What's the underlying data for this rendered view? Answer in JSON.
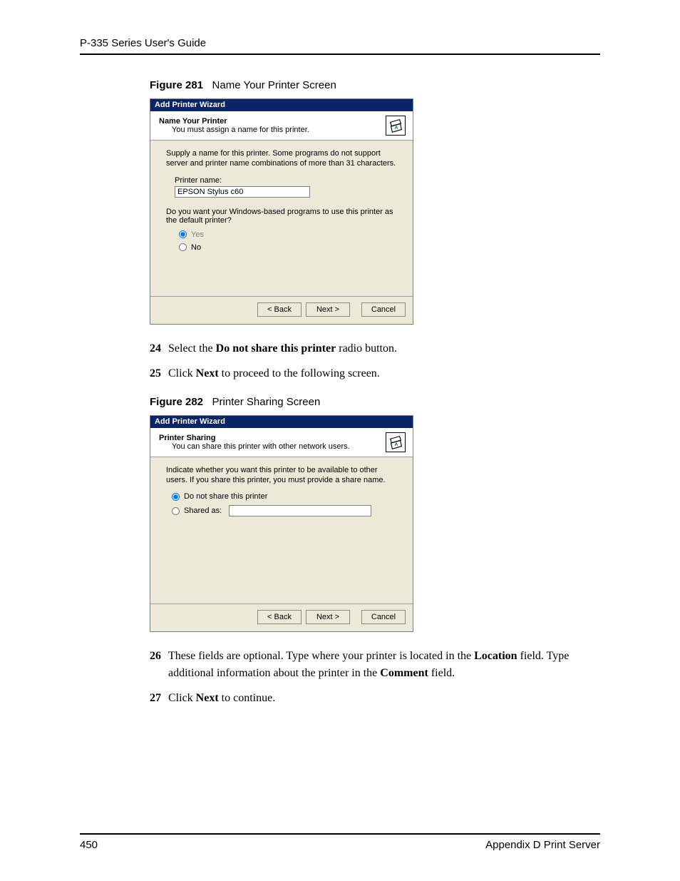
{
  "header": {
    "running_head": "P-335 Series User's Guide"
  },
  "figure281": {
    "caption_num": "Figure 281",
    "caption_title": "Name Your Printer Screen",
    "dialog": {
      "title": "Add Printer Wizard",
      "heading": "Name Your Printer",
      "sub": "You must assign a name for this printer.",
      "intro": "Supply a name for this printer. Some programs do not support server and printer name combinations of more than 31 characters.",
      "printer_name_label": "Printer name:",
      "printer_name_value": "EPSON Stylus c60",
      "question": "Do you want your Windows-based programs to use this printer as the default printer?",
      "yes": "Yes",
      "no": "No",
      "back": "< Back",
      "next": "Next >",
      "cancel": "Cancel"
    }
  },
  "steps_a": {
    "s24": {
      "num": "24",
      "text_pre": "Select the ",
      "bold": "Do not share this printer",
      "text_post": " radio button."
    },
    "s25": {
      "num": "25",
      "text_pre": "Click ",
      "bold": "Next",
      "text_post": " to proceed to the following screen."
    }
  },
  "figure282": {
    "caption_num": "Figure 282",
    "caption_title": "Printer Sharing Screen",
    "dialog": {
      "title": "Add Printer Wizard",
      "heading": "Printer Sharing",
      "sub": "You can share this printer with other network users.",
      "intro": "Indicate whether you want this printer to be available to other users. If you share this printer, you must provide a share name.",
      "opt_noshare": "Do not share this printer",
      "opt_shared": "Shared as:",
      "back": "< Back",
      "next": "Next >",
      "cancel": "Cancel"
    }
  },
  "steps_b": {
    "s26": {
      "num": "26",
      "text1": "These fields are optional. Type where your printer is located in the ",
      "bold1": "Location",
      "text2": " field. Type additional information about the printer in the ",
      "bold2": "Comment",
      "text3": " field."
    },
    "s27": {
      "num": "27",
      "text_pre": "Click ",
      "bold": "Next",
      "text_post": " to continue."
    }
  },
  "footer": {
    "page": "450",
    "section": "Appendix D Print Server"
  }
}
